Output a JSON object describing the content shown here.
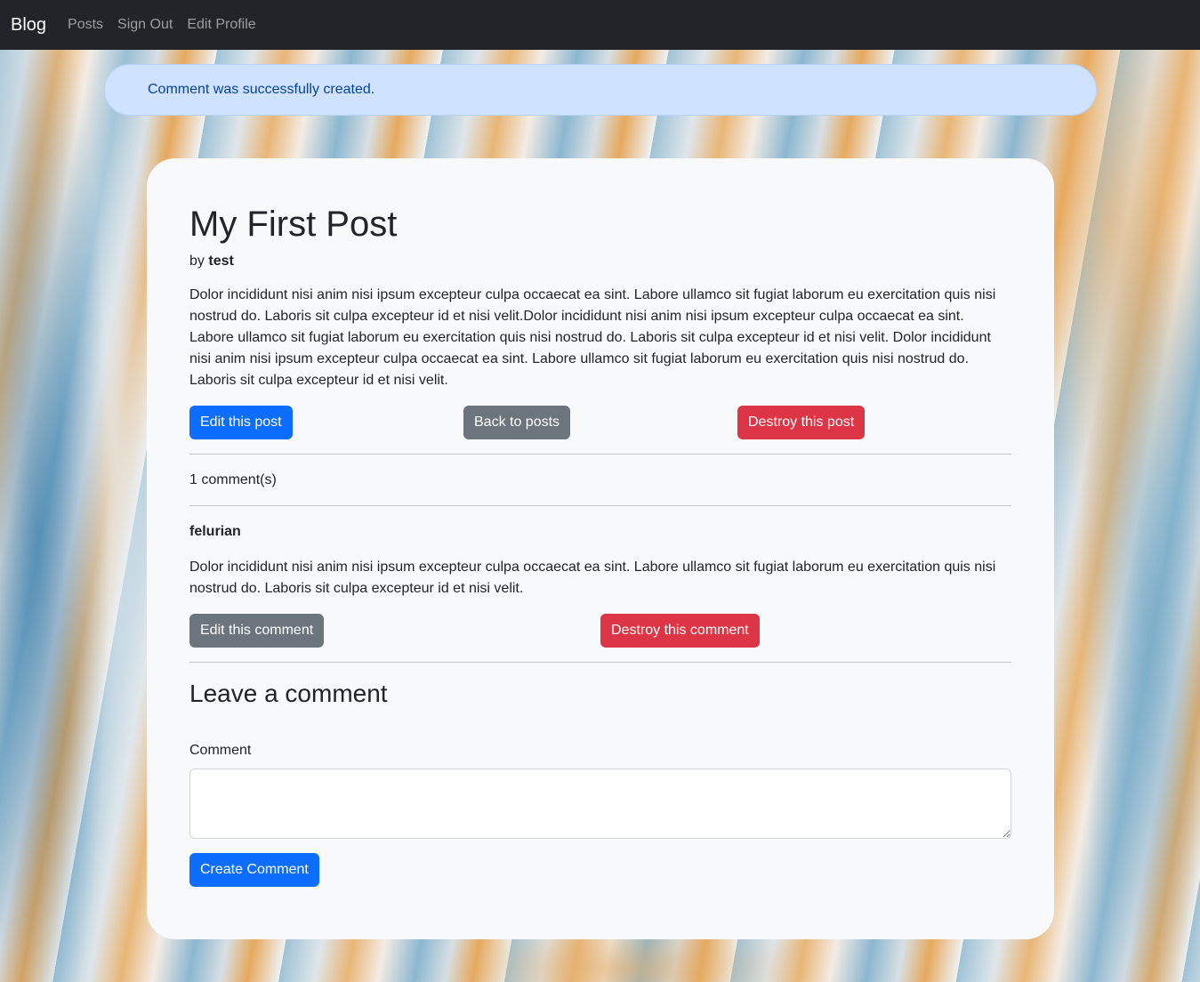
{
  "nav": {
    "brand": "Blog",
    "links": [
      "Posts",
      "Sign Out",
      "Edit Profile"
    ]
  },
  "alert": {
    "message": "Comment was successfully created."
  },
  "post": {
    "title": "My First Post",
    "by_prefix": "by",
    "author": "test",
    "body": "Dolor incididunt nisi anim nisi ipsum excepteur culpa occaecat ea sint. Labore ullamco sit fugiat laborum eu exercitation quis nisi nostrud do. Laboris sit culpa excepteur id et nisi velit.Dolor incididunt nisi anim nisi ipsum excepteur culpa occaecat ea sint. Labore ullamco sit fugiat laborum eu exercitation quis nisi nostrud do. Laboris sit culpa excepteur id et nisi velit. Dolor incididunt nisi anim nisi ipsum excepteur culpa occaecat ea sint. Labore ullamco sit fugiat laborum eu exercitation quis nisi nostrud do. Laboris sit culpa excepteur id et nisi velit.",
    "actions": {
      "edit": "Edit this post",
      "back": "Back to posts",
      "destroy": "Destroy this post"
    }
  },
  "comments": {
    "count_label": "1 comment(s)",
    "items": [
      {
        "author": "felurian",
        "body": "Dolor incididunt nisi anim nisi ipsum excepteur culpa occaecat ea sint. Labore ullamco sit fugiat laborum eu exercitation quis nisi nostrud do. Laboris sit culpa excepteur id et nisi velit.",
        "edit": "Edit this comment",
        "destroy": "Destroy this comment"
      }
    ]
  },
  "form": {
    "heading": "Leave a comment",
    "label": "Comment",
    "value": "",
    "submit": "Create Comment"
  },
  "colors": {
    "primary": "#0d6efd",
    "secondary": "#6c757d",
    "danger": "#dc3545",
    "navbar": "#212529",
    "alert_bg": "#cfe2ff"
  }
}
